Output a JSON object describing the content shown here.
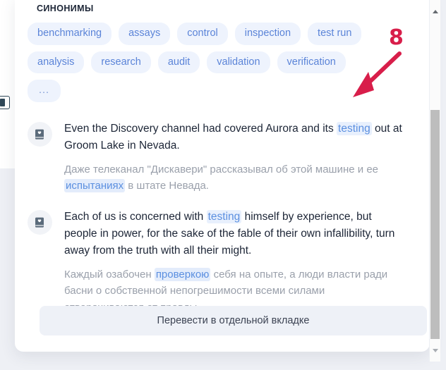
{
  "popup": {
    "section_label": "СИНОНИМЫ",
    "synonyms": [
      {
        "label": "benchmarking"
      },
      {
        "label": "assays"
      },
      {
        "label": "control"
      },
      {
        "label": "inspection"
      },
      {
        "label": "test run"
      },
      {
        "label": "analysis"
      },
      {
        "label": "research"
      },
      {
        "label": "audit"
      },
      {
        "label": "validation"
      },
      {
        "label": "verification"
      },
      {
        "label": "..."
      }
    ],
    "examples": [
      {
        "icon": "book-heart-icon",
        "source_pre": "Even the Discovery channel had covered Aurora and its ",
        "source_highlight": "testing",
        "source_post": " out at Groom Lake in Nevada.",
        "target_pre": "Даже телеканал \"Дискавери\" рассказывал об этой машине и ее ",
        "target_highlight": "испытаниях",
        "target_post": " в штате Невада."
      },
      {
        "icon": "book-heart-icon",
        "source_pre": "Each of us is concerned with ",
        "source_highlight": "testing",
        "source_post": " himself by experience, but people in power, for the sake of the fable of their own infallibility, turn away from the truth with all their might.",
        "target_pre": "Каждый озабочен ",
        "target_highlight": "проверкою",
        "target_post": " себя на опыте, а люди власти ради басни о собственной непогрешимости всеми силами отворачиваются от правды."
      }
    ],
    "translate_button_label": "Перевести в отдельной вкладке"
  },
  "annotation": {
    "number": "8",
    "color": "#d81e4a"
  },
  "scrollbar": {
    "up_arrow": "scroll-up-arrow",
    "down_arrow": "scroll-down-arrow"
  },
  "colors": {
    "chip_bg": "#eef3fd",
    "chip_text": "#5b84d8",
    "highlight_text": "#5b8fe0",
    "highlight_bg": "#e8f0fd",
    "button_bg": "#eef1f7",
    "page_bg": "#eef0f5"
  }
}
